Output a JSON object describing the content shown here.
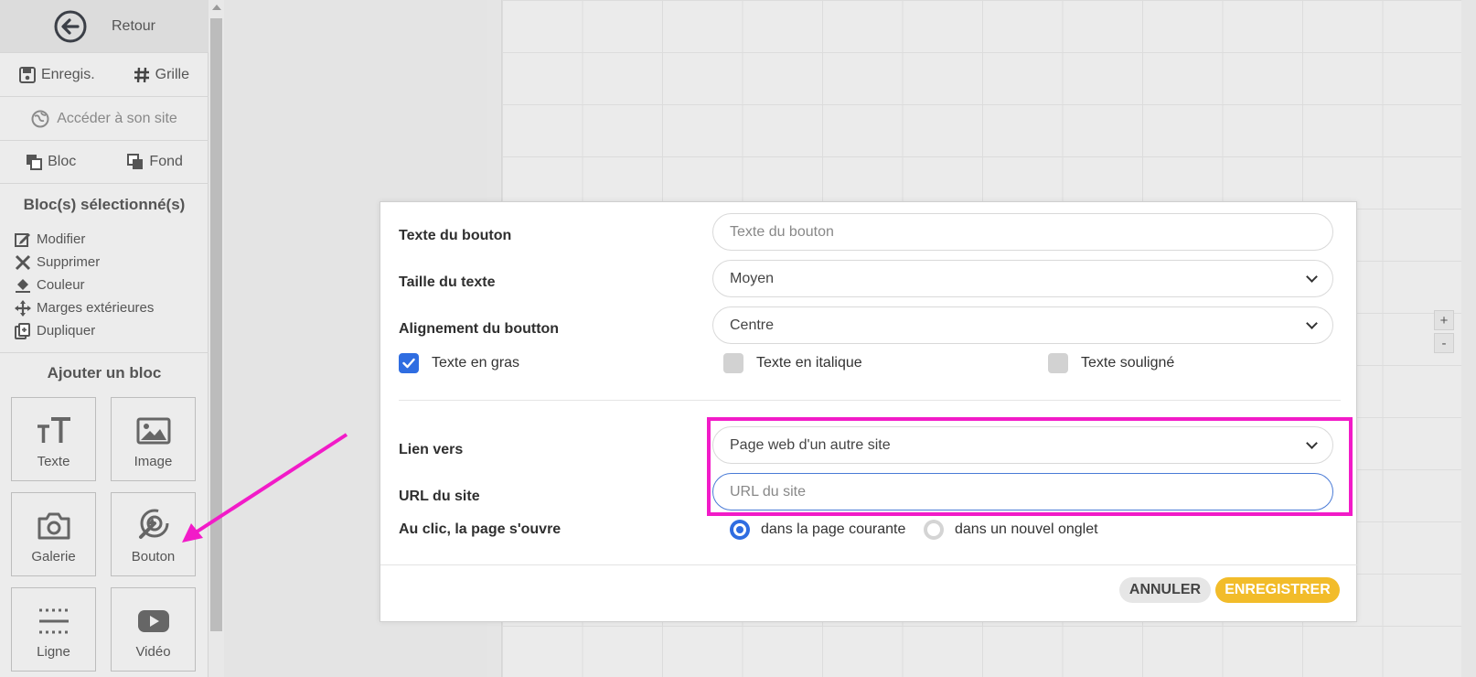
{
  "sidebar": {
    "back_label": "Retour",
    "save_label": "Enregis.",
    "grid_label": "Grille",
    "site_link_label": "Accéder à son site",
    "block_label": "Bloc",
    "background_label": "Fond",
    "selected_title": "Bloc(s) sélectionné(s)",
    "actions": [
      {
        "label": "Modifier",
        "icon": "edit-icon"
      },
      {
        "label": "Supprimer",
        "icon": "close-icon"
      },
      {
        "label": "Couleur",
        "icon": "paint-bucket-icon"
      },
      {
        "label": "Marges extérieures",
        "icon": "move-arrows-icon"
      },
      {
        "label": "Dupliquer",
        "icon": "duplicate-icon"
      }
    ],
    "add_title": "Ajouter un bloc",
    "tiles": [
      {
        "label": "Texte",
        "icon": "text-icon"
      },
      {
        "label": "Image",
        "icon": "image-icon"
      },
      {
        "label": "Galerie",
        "icon": "camera-icon"
      },
      {
        "label": "Bouton",
        "icon": "cursor-click-icon"
      },
      {
        "label": "Ligne",
        "icon": "line-icon"
      },
      {
        "label": "Vidéo",
        "icon": "youtube-icon"
      }
    ]
  },
  "zoom": {
    "plus": "+",
    "minus": "-"
  },
  "modal": {
    "button_text_label": "Texte du bouton",
    "button_text_placeholder": "Texte du bouton",
    "text_size_label": "Taille du texte",
    "text_size_value": "Moyen",
    "alignment_label": "Alignement du boutton",
    "alignment_value": "Centre",
    "bold_label": "Texte en gras",
    "bold_checked": true,
    "italic_label": "Texte en italique",
    "italic_checked": false,
    "underline_label": "Texte souligné",
    "underline_checked": false,
    "link_label": "Lien vers",
    "link_value": "Page web d'un autre site",
    "url_label": "URL du site",
    "url_placeholder": "URL du site",
    "open_label": "Au clic, la page s'ouvre",
    "open_current": "dans la page courante",
    "open_new_tab": "dans un nouvel onglet",
    "open_selected": "current",
    "cancel_label": "ANNULER",
    "save_label": "ENREGISTRER"
  },
  "colors": {
    "accent_blue": "#2f6de1",
    "save_yellow": "#f2bc2a",
    "highlight_magenta": "#f21bc8"
  }
}
